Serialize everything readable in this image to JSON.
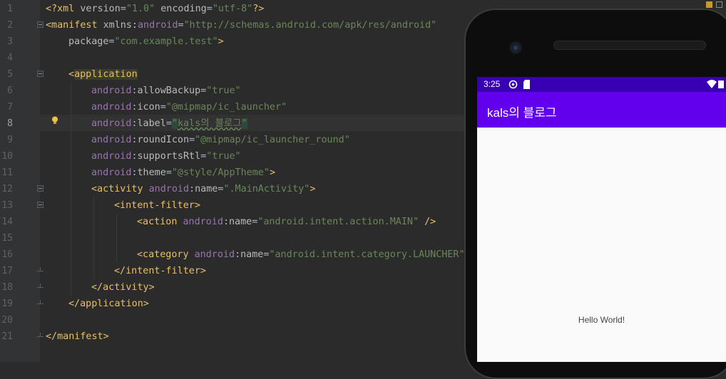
{
  "editor": {
    "line_numbers": [
      "1",
      "2",
      "3",
      "4",
      "5",
      "6",
      "7",
      "8",
      "9",
      "10",
      "11",
      "12",
      "13",
      "14",
      "15",
      "16",
      "17",
      "18",
      "19",
      "20",
      "21"
    ],
    "current_line": "8",
    "lines": {
      "l1": {
        "a": "<?xml ",
        "b": "version",
        "c": "=",
        "d": "\"1.0\"",
        "e": " encoding",
        "f": "=",
        "g": "\"utf-8\"",
        "h": "?>"
      },
      "l2": {
        "a": "<manifest ",
        "b": "xmlns:",
        "c": "android",
        "d": "=",
        "e": "\"http://schemas.android.com/apk/res/android\""
      },
      "l3": {
        "a": "package",
        "b": "=",
        "c": "\"com.example.test\"",
        "d": ">"
      },
      "l5": {
        "a": "<",
        "b": "application"
      },
      "l6": {
        "a": "android",
        ":": ":",
        "b": "allowBackup",
        "c": "=",
        "d": "\"true\""
      },
      "l7": {
        "a": "android",
        ":": ":",
        "b": "icon",
        "c": "=",
        "d": "\"@mipmap/ic_launcher\""
      },
      "l8": {
        "a": "android",
        ":": ":",
        "b": "label",
        "c": "=",
        "q1": "\"",
        "d": "kals의 블로그",
        "q2": "\""
      },
      "l9": {
        "a": "android",
        ":": ":",
        "b": "roundIcon",
        "c": "=",
        "d": "\"@mipmap/ic_launcher_round\""
      },
      "l10": {
        "a": "android",
        ":": ":",
        "b": "supportsRtl",
        "c": "=",
        "d": "\"true\""
      },
      "l11": {
        "a": "android",
        ":": ":",
        "b": "theme",
        "c": "=",
        "d": "\"@style/AppTheme\"",
        "e": ">"
      },
      "l12": {
        "a": "<activity ",
        "b": "android",
        ":": ":",
        "c": "name",
        "d": "=",
        "e": "\".MainActivity\"",
        "f": ">"
      },
      "l13": {
        "a": "<intent-filter>"
      },
      "l14": {
        "a": "<action ",
        "b": "android",
        ":": ":",
        "c": "name",
        "d": "=",
        "e": "\"android.intent.action.MAIN\"",
        "f": " />"
      },
      "l16": {
        "a": "<category ",
        "b": "android",
        ":": ":",
        "c": "name",
        "d": "=",
        "e": "\"android.intent.category.LAUNCHER\""
      },
      "l17": {
        "a": "</intent-filter>"
      },
      "l18": {
        "a": "</activity>"
      },
      "l19": {
        "a": "</application>"
      },
      "l21": {
        "a": "</manifest>"
      }
    }
  },
  "emulator": {
    "status_time": "3:25",
    "app_title": "kals의 블로그",
    "content_text": "Hello World!",
    "colors": {
      "status_bar": "#3700b3",
      "app_bar": "#6200ee",
      "background": "#fafafa"
    }
  },
  "icons": [
    "lightbulb-icon",
    "fold-marker-icon",
    "camera-icon",
    "speaker-icon",
    "wifi-icon",
    "battery-icon",
    "sync-icon",
    "sd-card-icon"
  ]
}
